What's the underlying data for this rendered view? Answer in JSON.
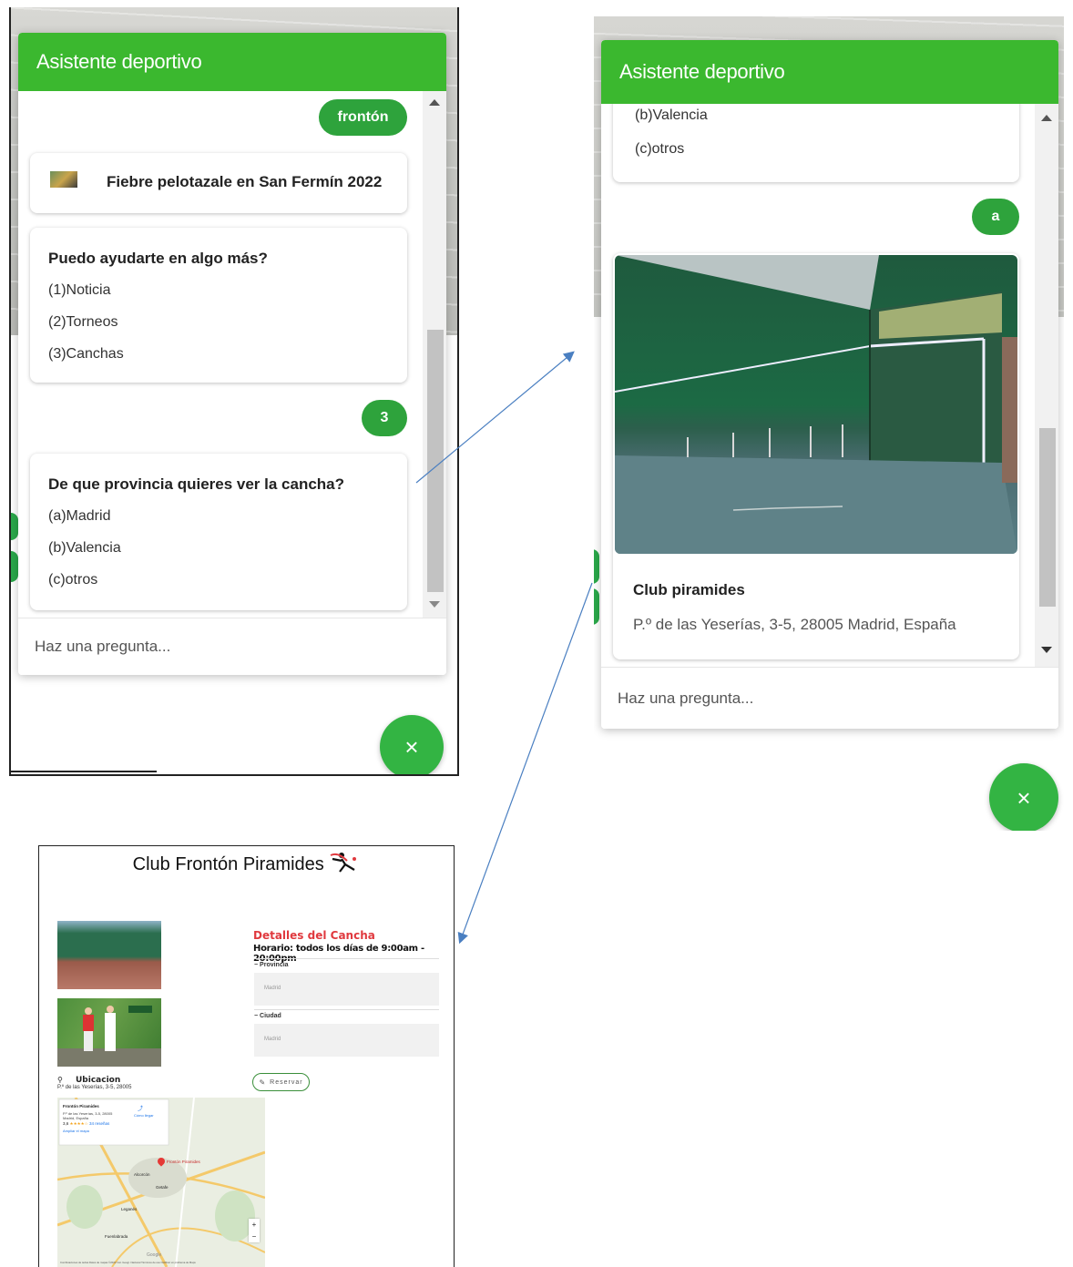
{
  "chat1": {
    "title": "Asistente deportivo",
    "user_msg_1": "frontón",
    "news_item": "Fiebre pelotazale en San Fermín 2022",
    "menu": {
      "question": "Puedo ayudarte en algo más?",
      "options": [
        "(1)Noticia",
        "(2)Torneos",
        "(3)Canchas"
      ]
    },
    "user_msg_2": "3",
    "province": {
      "question": "De que provincia quieres ver la cancha?",
      "options": [
        "(a)Madrid",
        "(b)Valencia",
        "(c)otros"
      ]
    },
    "input_placeholder": "Haz una pregunta...",
    "close_icon": "×"
  },
  "chat2": {
    "title": "Asistente deportivo",
    "prev_options": [
      "(b)Valencia",
      "(c)otros"
    ],
    "user_msg": "a",
    "club_name": "Club piramides",
    "club_address": "P.º de las Yeserías, 3-5, 28005 Madrid, España",
    "input_placeholder": "Haz una pregunta...",
    "close_icon": "×"
  },
  "club_page": {
    "title": "Club Frontón Piramides",
    "details_title": "Detalles del Cancha",
    "schedule": "Horario: todos los días de 9:00am - 20:00pm",
    "fields": [
      {
        "label": "Provincia",
        "value": "Madrid"
      },
      {
        "label": "Ciudad",
        "value": "Madrid"
      }
    ],
    "reserve_button": "Reservar",
    "location_label": "Ubicacion",
    "location_address": "P.º de las Yeserías, 3-5, 28005",
    "map": {
      "place_name": "Frontón Piramides",
      "place_address_1": "P.º de las Yeserías, 3-5, 28005",
      "place_address_2": "Madrid, España",
      "rating": "3,6",
      "stars": "★★★★☆",
      "reviews": "34 reseñas",
      "directions": "Cómo llegar",
      "enlarge": "Ampliar el mapa",
      "pin_label": "Frontón Piramides",
      "cities": [
        "Alcorcón",
        "Getafe",
        "Fuenlabrada",
        "Leganés"
      ],
      "zoom_in": "+",
      "zoom_out": "−",
      "google": "Google",
      "footer": "Combinaciones de teclas   Datos de mapas ©2022 Inst. Geogr. Nacional   Términos de uso   Notificar un problema de Maps"
    }
  },
  "colors": {
    "header_green": "#3bb82f",
    "bubble_green": "#2ea33c",
    "accent_red": "#e0393e",
    "arrow_blue": "#4a7fc1"
  }
}
